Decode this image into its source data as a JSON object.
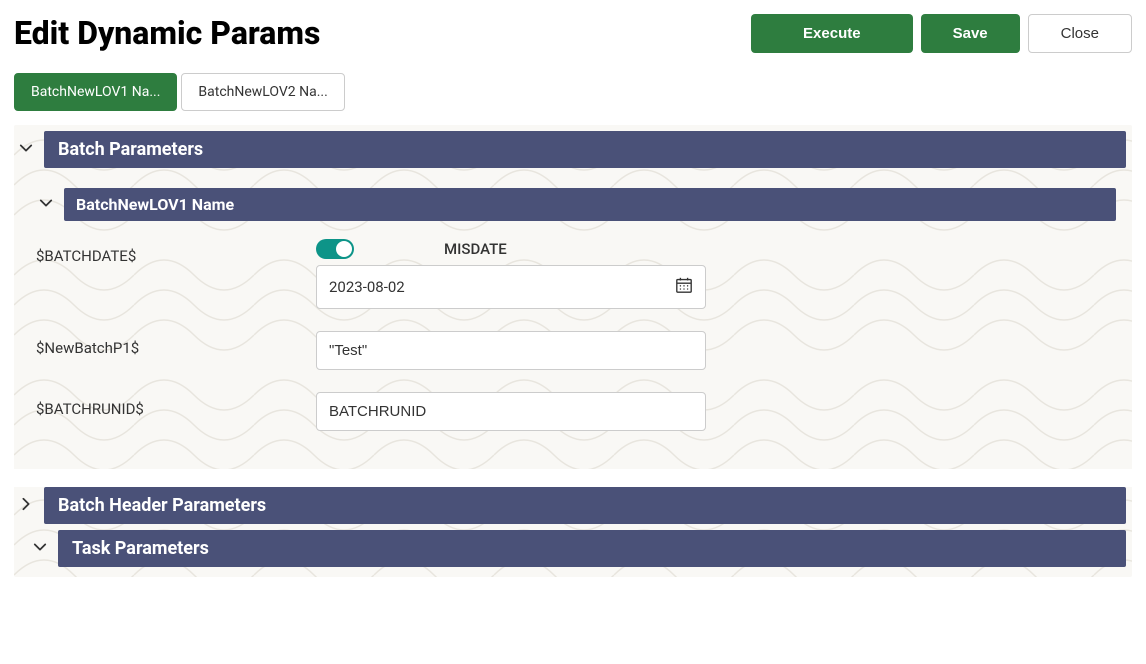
{
  "page_title": "Edit Dynamic Params",
  "actions": {
    "execute": "Execute",
    "save": "Save",
    "close": "Close"
  },
  "tabs": [
    {
      "label": "BatchNewLOV1 Na...",
      "active": true
    },
    {
      "label": "BatchNewLOV2 Na...",
      "active": false
    }
  ],
  "sections": {
    "batch_params": {
      "title": "Batch Parameters",
      "expanded": true,
      "subsection": {
        "title": "BatchNewLOV1 Name",
        "expanded": true,
        "rows": [
          {
            "label": "$BATCHDATE$",
            "toggle": true,
            "toggle_label": "MISDATE",
            "type": "date",
            "value": "2023-08-02"
          },
          {
            "label": "$NewBatchP1$",
            "type": "text",
            "value": "\"Test\""
          },
          {
            "label": "$BATCHRUNID$",
            "type": "text",
            "value": "BATCHRUNID"
          }
        ]
      }
    },
    "batch_header": {
      "title": "Batch Header Parameters",
      "expanded": false
    },
    "task_params": {
      "title": "Task Parameters",
      "expanded": true
    }
  }
}
